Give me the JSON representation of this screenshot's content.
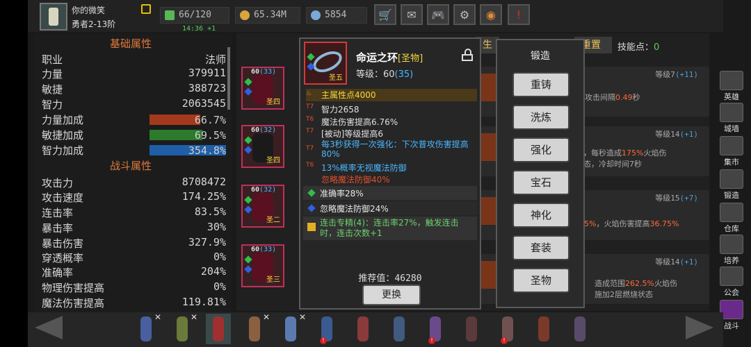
{
  "player": {
    "name": "你的微笑",
    "rank": "勇者2-13阶"
  },
  "resources": {
    "energy": "66/120",
    "energy_timer": "14:36 +1",
    "gold": "65.34M",
    "gems": "5854"
  },
  "toolbar": [
    "shop-icon",
    "mail-icon",
    "gamepad-icon",
    "gear-icon",
    "wheel-icon",
    "event-icon"
  ],
  "basic_attrs": {
    "title": "基础属性",
    "rows": [
      {
        "label": "职业",
        "value": "法师"
      },
      {
        "label": "力量",
        "value": "379911"
      },
      {
        "label": "敏捷",
        "value": "388723"
      },
      {
        "label": "智力",
        "value": "2063545"
      }
    ],
    "bars": [
      {
        "label": "力量加成",
        "value": "66.7%",
        "fill": 0.667,
        "color": "#a5391d"
      },
      {
        "label": "敏捷加成",
        "value": "69.5%",
        "fill": 0.695,
        "color": "#2c7a2c"
      },
      {
        "label": "智力加成",
        "value": "354.8%",
        "fill": 1.0,
        "color": "#1e5fa8"
      }
    ]
  },
  "combat_attrs": {
    "title": "战斗属性",
    "rows": [
      {
        "label": "攻击力",
        "value": "8708472"
      },
      {
        "label": "攻击速度",
        "value": "174.25%"
      },
      {
        "label": "连击率",
        "value": "83.5%"
      },
      {
        "label": "暴击率",
        "value": "30%"
      },
      {
        "label": "暴击伤害",
        "value": "327.9%"
      },
      {
        "label": "穿透概率",
        "value": "0%"
      },
      {
        "label": "准确率",
        "value": "204%"
      },
      {
        "label": "物理伤害提高",
        "value": "0%"
      },
      {
        "label": "魔法伤害提高",
        "value": "119.81%"
      }
    ]
  },
  "equipment": [
    {
      "level": "60",
      "sub": "(33)",
      "tag": "圣四"
    },
    {
      "level": "60",
      "sub": "(32)",
      "tag": "圣四"
    },
    {
      "level": "60",
      "sub": "(32)",
      "tag": "圣二"
    },
    {
      "level": "60",
      "sub": "(33)",
      "tag": "圣三"
    }
  ],
  "skill_cards": [
    {
      "level": "等级7",
      "bonus": "(+11)",
      "desc_pre": "，攻击间隔",
      "desc_hl": "0.49",
      "desc_post": "秒",
      "desc2": ""
    },
    {
      "level": "等级14",
      "bonus": "(+1)",
      "desc_pre": "秒，每秒造成",
      "desc_hl": "175%",
      "desc_post": "火焰伤",
      "desc2": "状态，冷却时间7秒"
    },
    {
      "level": "等级15",
      "bonus": "(+7)",
      "desc_pre": "",
      "desc_hl": "5%",
      "desc_post": "，火焰伤害提高",
      "desc2": "36.75%"
    },
    {
      "level": "等级14",
      "bonus": "(+1)",
      "desc_pre": "造成范围",
      "desc_hl": "262.5%",
      "desc_post": "火焰伤",
      "desc2": "施加2层燃烧状态"
    }
  ],
  "skill_points_label": "技能点：",
  "skill_points_value": "0",
  "tabs_partial": [
    "生",
    "重置"
  ],
  "nav": [
    {
      "label": "英雄",
      "icon": "hero-icon"
    },
    {
      "label": "城墙",
      "icon": "wall-icon"
    },
    {
      "label": "集市",
      "icon": "market-icon"
    },
    {
      "label": "锻造",
      "icon": "anvil-icon"
    },
    {
      "label": "仓库",
      "icon": "warehouse-icon"
    },
    {
      "label": "培养",
      "icon": "train-icon"
    },
    {
      "label": "公会",
      "icon": "guild-icon"
    },
    {
      "label": "战斗",
      "icon": "battle-icon"
    }
  ],
  "tooltip": {
    "name": "命运之环",
    "quality": "[圣物]",
    "level_label": "等级：60",
    "level_bonus": "(35)",
    "item_tag": "圣五",
    "main_attr": "主属性点4000",
    "lines": [
      {
        "tier": "T7",
        "text": "智力2658",
        "color": "white"
      },
      {
        "tier": "T6",
        "text": "魔法伤害提高6.76%",
        "color": "white"
      },
      {
        "tier": "T7",
        "text": "[被动]等级提高6",
        "color": "white"
      },
      {
        "tier": "T7",
        "text": "每3秒获得一次强化：下次普攻伤害提高80%",
        "color": "blue"
      },
      {
        "tier": "T6",
        "text": "13%概率无视魔法防御",
        "color": "blue"
      },
      {
        "tier": "",
        "text": "忽略魔法防御40%",
        "color": "red"
      }
    ],
    "gem1": "准确率28%",
    "gem2": "忽略魔法防御24%",
    "set_bonus": "连击专精(4)：连击率27%，触发连击时，连击次数+1",
    "recommend_label": "推荐值：",
    "recommend_value": "46280",
    "replace_button": "更换"
  },
  "forge": {
    "title": "锻造",
    "buttons": [
      "重铸",
      "洗炼",
      "强化",
      "宝石",
      "神化",
      "套装",
      "圣物"
    ]
  },
  "heroes": [
    {
      "color": "#4a5fa0",
      "x": true
    },
    {
      "color": "#6a7a3a",
      "x": true
    },
    {
      "color": "#a03030",
      "x": false,
      "selected": true
    },
    {
      "color": "#8a6040",
      "x": true
    },
    {
      "color": "#5a7ab0",
      "x": true
    },
    {
      "color": "#3a5a90",
      "x": false,
      "alert": true
    },
    {
      "color": "#8a3a3a",
      "x": false
    },
    {
      "color": "#405a80",
      "x": false
    },
    {
      "color": "#6a4a8a",
      "x": false,
      "alert": true
    },
    {
      "color": "#5a3a3a",
      "x": false
    },
    {
      "color": "#705050",
      "x": false,
      "alert": true
    },
    {
      "color": "#7a3a2a",
      "x": false
    },
    {
      "color": "#5a4a6a",
      "x": false
    }
  ]
}
